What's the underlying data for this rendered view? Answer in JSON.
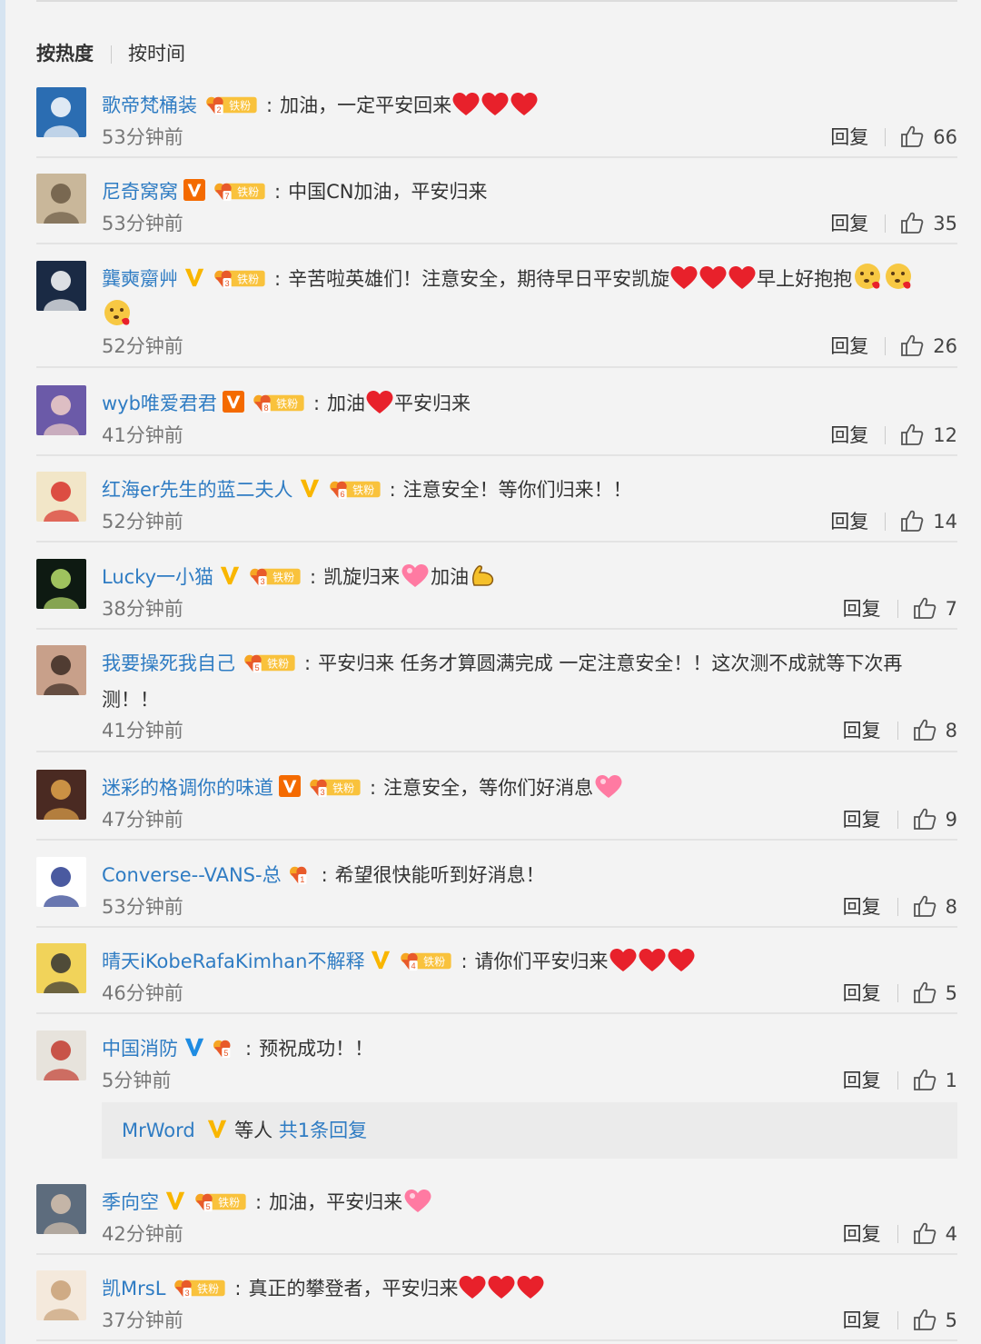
{
  "sort_tabs": {
    "hot": "按热度",
    "time": "按时间"
  },
  "reply_label": "回复",
  "comments": [
    {
      "user": "歌帝梵桶装",
      "badge": "none",
      "fan": "铁粉",
      "fan_level": "2",
      "text": "加油，一定平安回来",
      "emoji": "❤️❤️❤️",
      "time": "53分钟前",
      "likes": "66"
    },
    {
      "user": "尼奇窝窝",
      "badge": "V-orange",
      "fan": "铁粉",
      "fan_level": "7",
      "text": "中国CN加油，平安归来",
      "emoji": "",
      "time": "53分钟前",
      "likes": "35"
    },
    {
      "user": "龔奭䶒艸",
      "badge": "V-yellow",
      "fan": "铁粉",
      "fan_level": "3",
      "text": "辛苦啦英雄们！注意安全，期待早日平安凯旋",
      "emoji": "❤️❤️❤️",
      "text2": "早上好抱抱",
      "emoji2": "🥰🥰",
      "continuation_emoji": "🥰",
      "time": "52分钟前",
      "likes": "26"
    },
    {
      "user": "wyb唯爱君君",
      "badge": "V-orange",
      "fan": "铁粉",
      "fan_level": "8",
      "text": "加油",
      "emoji": "❤️",
      "text2": "平安归来",
      "time": "41分钟前",
      "likes": "12"
    },
    {
      "user": "红海er先生的蓝二夫人",
      "badge": "V-yellow",
      "fan": "铁粉",
      "fan_level": "6",
      "text": "注意安全！等你们归来！！",
      "emoji": "",
      "time": "52分钟前",
      "likes": "14"
    },
    {
      "user": "Lucky一小猫",
      "badge": "V-yellow",
      "fan": "铁粉",
      "fan_level": "3",
      "text": "凯旋归来",
      "emoji": "💖",
      "text2": "加油",
      "emoji2": "💪",
      "time": "38分钟前",
      "likes": "7"
    },
    {
      "user": "我要操死我自己",
      "badge": "none",
      "fan": "铁粉",
      "fan_level": "5",
      "text": "平安归来 任务才算圆满完成 一定注意安全！！这次测不成就等下次再",
      "continuation": "测！！",
      "emoji": "",
      "time": "41分钟前",
      "likes": "8"
    },
    {
      "user": "迷彩的格调你的味道",
      "badge": "V-orange",
      "fan": "铁粉",
      "fan_level": "3",
      "text": "注意安全，等你们好消息",
      "emoji": "💖",
      "time": "47分钟前",
      "likes": "9"
    },
    {
      "user": "Converse--VANS-总",
      "badge": "none",
      "fan": "",
      "fan_level": "1",
      "text": "希望很快能听到好消息！",
      "emoji": "",
      "time": "53分钟前",
      "likes": "8"
    },
    {
      "user": "晴天iKobeRafaKimhan不解释",
      "badge": "V-yellow",
      "fan": "铁粉",
      "fan_level": "4",
      "text": "请你们平安归来",
      "emoji": "❤️❤️❤️",
      "time": "46分钟前",
      "likes": "5"
    },
    {
      "user": "中国消防",
      "badge": "V-blue",
      "fan": "",
      "fan_level": "5",
      "text": "预祝成功！！",
      "emoji": "",
      "time": "5分钟前",
      "likes": "1"
    },
    {
      "user": "季向空",
      "badge": "V-yellow",
      "fan": "铁粉",
      "fan_level": "5",
      "text": "加油，平安归来",
      "emoji": "💖",
      "time": "42分钟前",
      "likes": "4"
    },
    {
      "user": "凯MrsL",
      "badge": "none",
      "fan": "铁粉",
      "fan_level": "3",
      "text": "真正的攀登者，平安归来",
      "emoji": "❤️❤️❤️",
      "time": "37分钟前",
      "likes": "5"
    }
  ],
  "replies_box": {
    "user": "MrWord",
    "middle": "等人",
    "link": "共1条回复"
  },
  "icons": {
    "like": "thumbs-up-icon",
    "verified": "verified-v-icon",
    "fan": "fan-badge-icon"
  },
  "colors": {
    "link": "#2f7cc3",
    "v_orange": "#f46a00",
    "v_yellow": "#f9b600",
    "v_blue": "#1e8ce2",
    "heart": "#e8212b"
  }
}
